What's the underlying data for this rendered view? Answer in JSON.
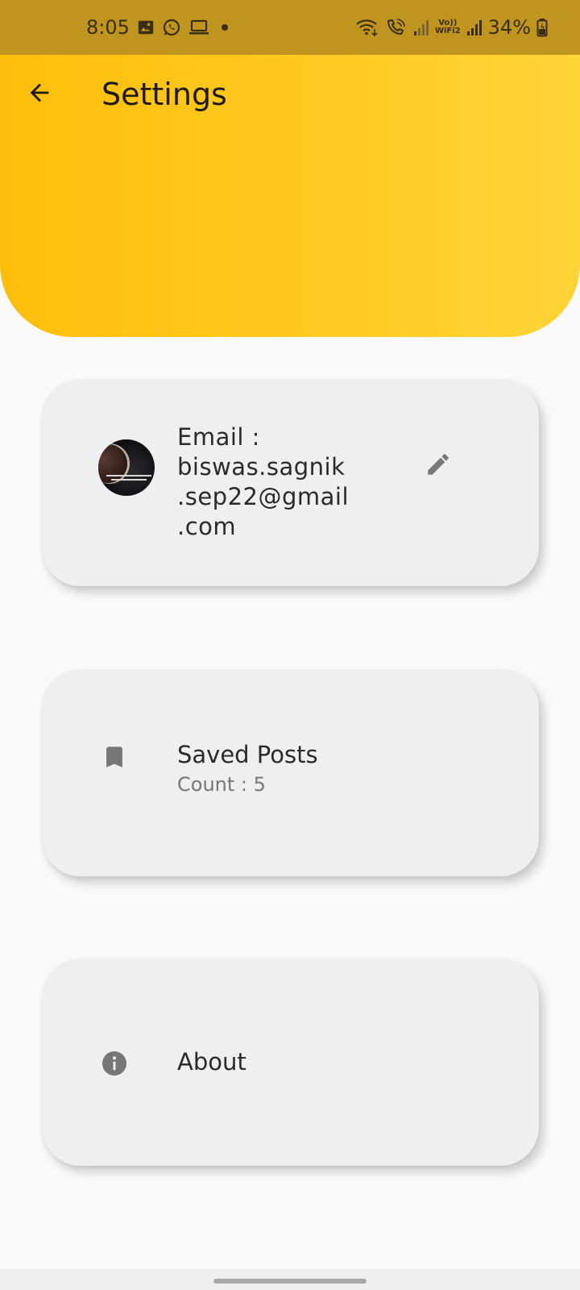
{
  "status_bar": {
    "time": "8:05",
    "battery": "34%",
    "volte_top": "Vo))",
    "volte_bottom": "WiFi2",
    "icons": [
      "image-icon",
      "whatsapp-icon",
      "laptop-icon",
      "dot-icon",
      "wifi-icon",
      "wifi-call-icon",
      "signal-icon",
      "signal-icon",
      "battery-icon"
    ]
  },
  "header": {
    "title": "Settings",
    "back_icon": "arrow-back-icon"
  },
  "email_card": {
    "label": "Email :",
    "lines": [
      "biswas.sagnik",
      ".sep22@gmail",
      ".com"
    ],
    "edit_icon": "pencil-icon"
  },
  "saved_card": {
    "title": "Saved Posts",
    "count": "Count : 5",
    "icon": "bookmark-icon"
  },
  "about_card": {
    "title": "About",
    "icon": "info-icon"
  },
  "colors": {
    "header_start": "#ffbe0a",
    "header_end": "#ffd438",
    "status_bar": "#bf9520",
    "card": "#efefef",
    "icon_gray": "#777777"
  }
}
